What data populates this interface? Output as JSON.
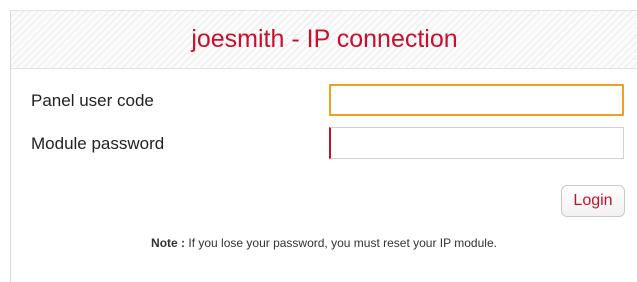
{
  "title": "joesmith - IP connection",
  "form": {
    "panel_user_code_label": "Panel user code",
    "panel_user_code_value": "",
    "module_password_label": "Module password",
    "module_password_value": ""
  },
  "login_label": "Login",
  "note": {
    "label": "Note :",
    "text": " If you lose your password, you must reset your IP module."
  },
  "colors": {
    "accent": "#c8102e",
    "focus_border": "#f0a020"
  }
}
